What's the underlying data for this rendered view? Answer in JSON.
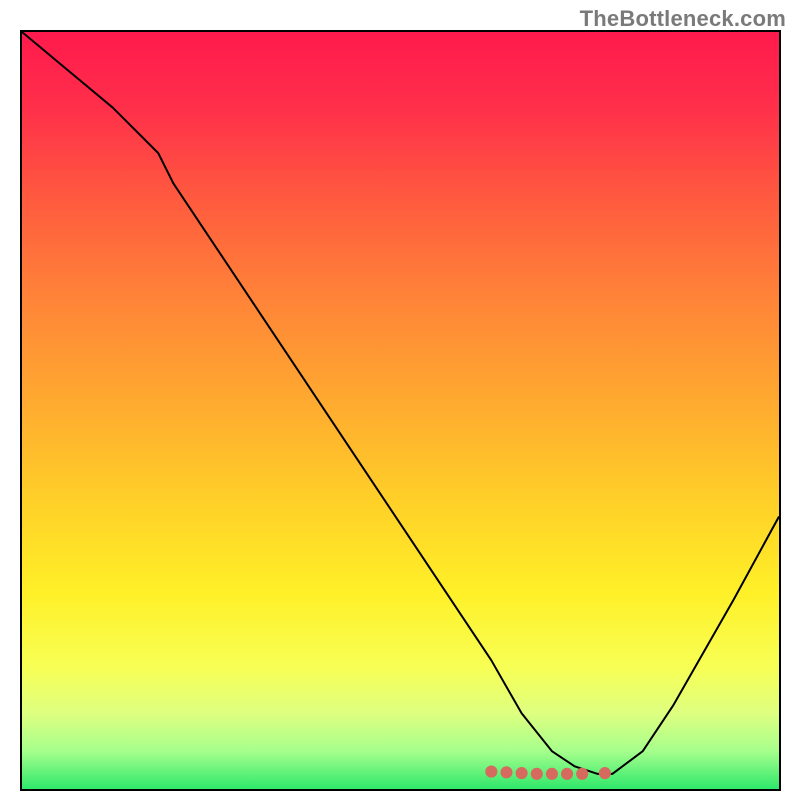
{
  "watermark": "TheBottleneck.com",
  "gradient": {
    "stops": [
      {
        "offset": 0.0,
        "color": "#ff1a4d"
      },
      {
        "offset": 0.1,
        "color": "#ff2f4a"
      },
      {
        "offset": 0.22,
        "color": "#ff5a3f"
      },
      {
        "offset": 0.35,
        "color": "#ff8338"
      },
      {
        "offset": 0.5,
        "color": "#ffad2f"
      },
      {
        "offset": 0.62,
        "color": "#ffd028"
      },
      {
        "offset": 0.74,
        "color": "#fff028"
      },
      {
        "offset": 0.84,
        "color": "#f7ff55"
      },
      {
        "offset": 0.9,
        "color": "#deff80"
      },
      {
        "offset": 0.95,
        "color": "#a6ff8c"
      },
      {
        "offset": 1.0,
        "color": "#2ee86b"
      }
    ]
  },
  "chart_data": {
    "type": "line",
    "title": "",
    "xlabel": "",
    "ylabel": "",
    "xlim": [
      0,
      100
    ],
    "ylim": [
      0,
      100
    ],
    "series": [
      {
        "name": "bottleneck-curve",
        "x": [
          0,
          6,
          12,
          18,
          20,
          26,
          32,
          38,
          44,
          50,
          56,
          62,
          66,
          70,
          73,
          76,
          78,
          82,
          86,
          90,
          94,
          100
        ],
        "y": [
          100,
          95,
          90,
          84,
          80,
          71,
          62,
          53,
          44,
          35,
          26,
          17,
          10,
          5,
          3,
          2,
          2,
          5,
          11,
          18,
          25,
          36
        ]
      }
    ],
    "markers": {
      "name": "threshold-markers",
      "color": "#d66a5e",
      "x": [
        62,
        64,
        66,
        68,
        70,
        72,
        74,
        77
      ],
      "y": [
        2.3,
        2.2,
        2.1,
        2.0,
        2.0,
        2.0,
        2.0,
        2.1
      ]
    }
  }
}
